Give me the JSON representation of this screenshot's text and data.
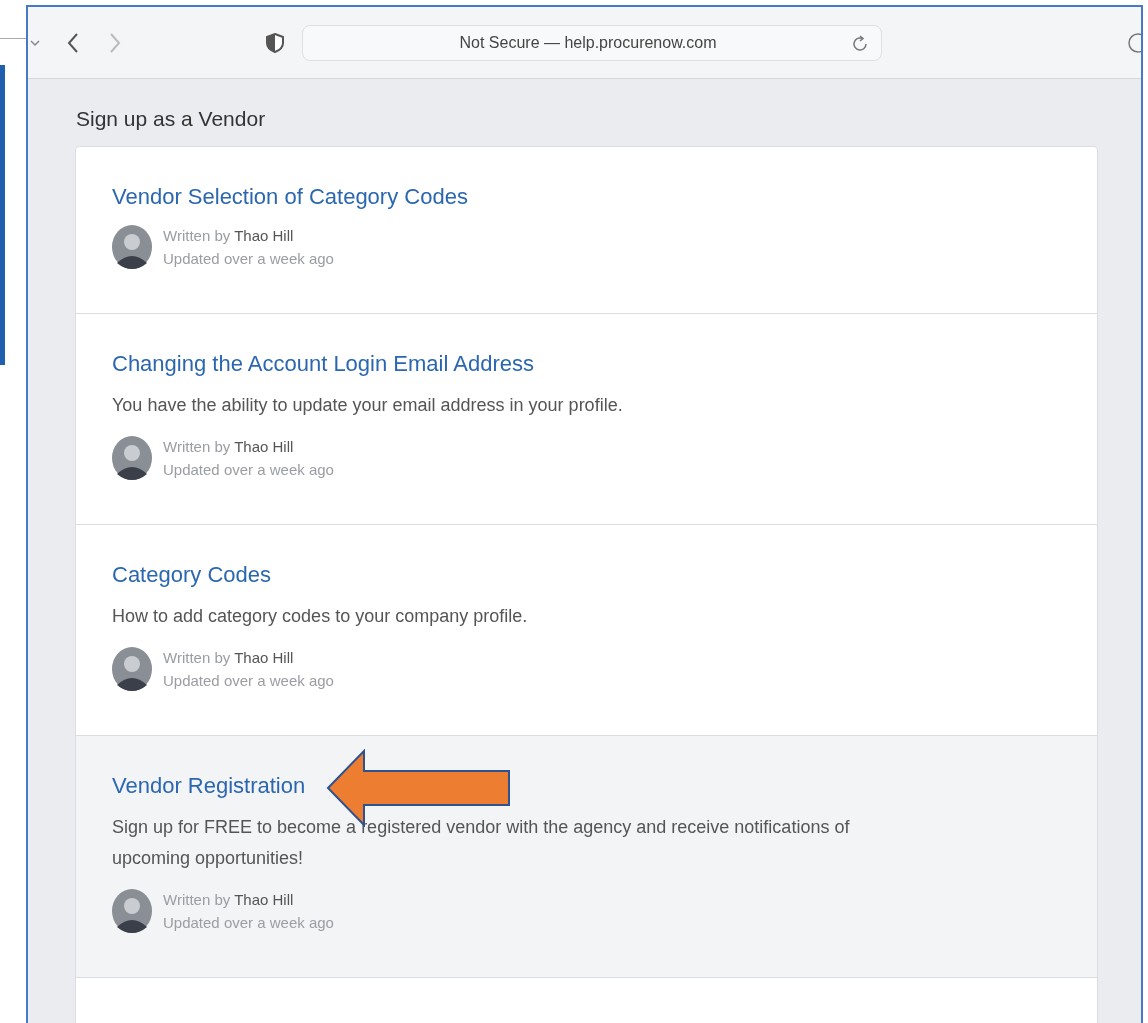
{
  "browser": {
    "address": "Not Secure — help.procurenow.com",
    "forward_disabled": true
  },
  "page": {
    "heading": "Sign up as a Vendor",
    "articles": [
      {
        "title": "Vendor Selection of Category Codes",
        "written_by": "Written by",
        "author": "Thao Hill",
        "updated": "Updated over a week ago",
        "highlighted": false
      },
      {
        "title": "Changing the Account Login Email Address",
        "description": "You have the ability to update your email address in your profile.",
        "written_by": "Written by",
        "author": "Thao Hill",
        "updated": "Updated over a week ago",
        "highlighted": false
      },
      {
        "title": "Category Codes",
        "description": "How to add category codes to your company profile.",
        "written_by": "Written by",
        "author": "Thao Hill",
        "updated": "Updated over a week ago",
        "highlighted": false
      },
      {
        "title": "Vendor Registration",
        "description": "Sign up for FREE to become a registered vendor with the agency and receive notifications of upcoming opportunities!",
        "written_by": "Written by",
        "author": "Thao Hill",
        "updated": "Updated over a week ago",
        "highlighted": true
      }
    ]
  }
}
